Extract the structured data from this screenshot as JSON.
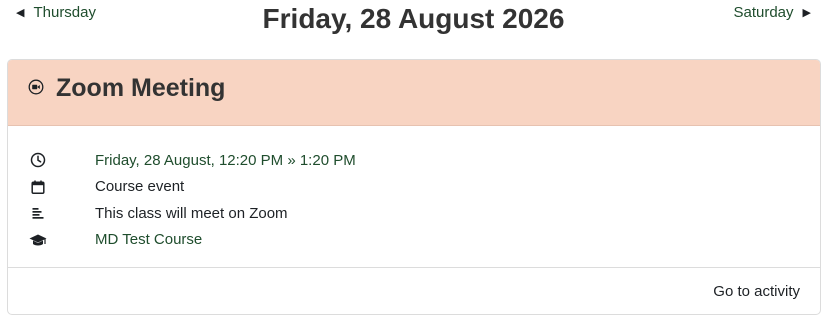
{
  "nav": {
    "prev_label": "Thursday",
    "next_label": "Saturday"
  },
  "page": {
    "title": "Friday, 28 August 2026"
  },
  "event": {
    "title": "Zoom Meeting",
    "header_icon": "video-camera-icon",
    "details": [
      {
        "icon": "clock-icon",
        "text": "Friday, 28 August, 12:20 PM » 1:20 PM"
      },
      {
        "icon": "calendar-icon",
        "text": "Course event"
      },
      {
        "icon": "description-icon",
        "text": "This class will meet on Zoom"
      },
      {
        "icon": "graduation-cap-icon",
        "text": "MD Test Course"
      }
    ],
    "action_label": "Go to activity"
  },
  "colors": {
    "header_bg": "#f8d4c2",
    "link": "#1f4d2d"
  }
}
